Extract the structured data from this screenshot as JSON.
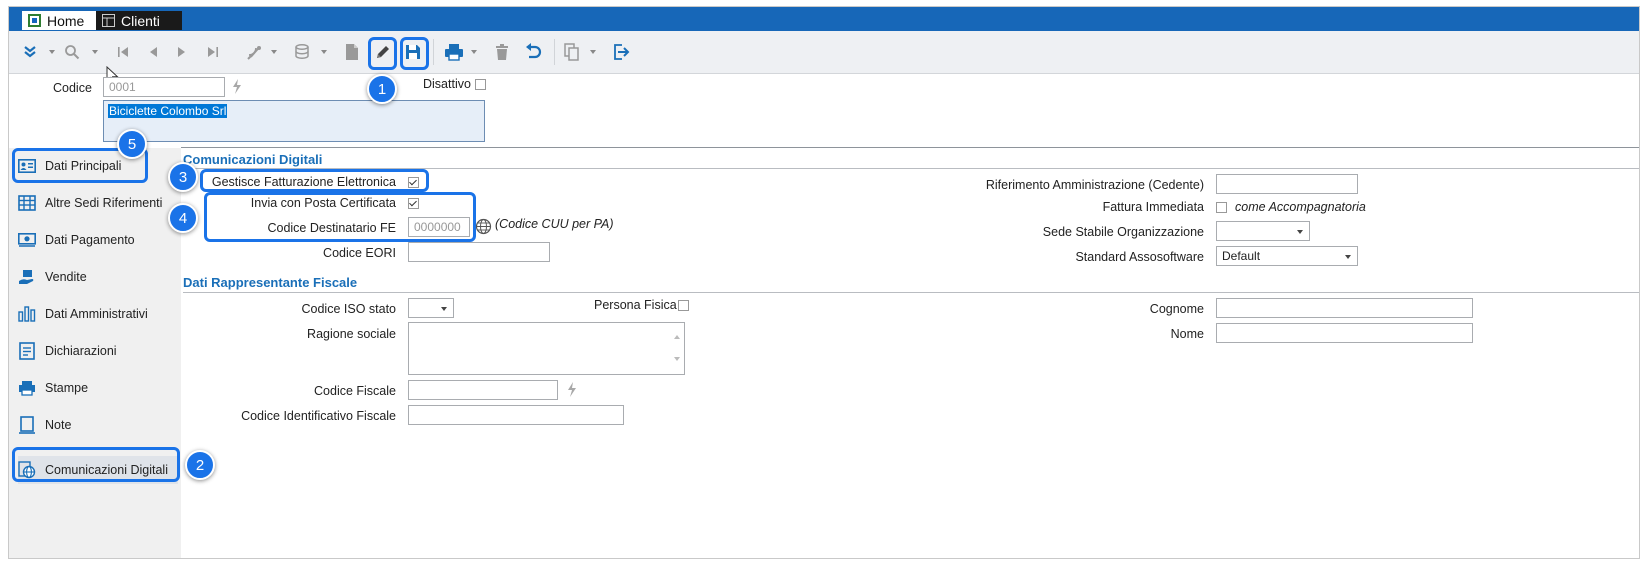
{
  "tabs": [
    {
      "label": "Home"
    },
    {
      "label": "Clienti"
    }
  ],
  "header": {
    "codice_label": "Codice",
    "codice_value": "0001",
    "disattivo_label": "Disattivo",
    "ragione": "Biciclette Colombo Srl"
  },
  "callouts": [
    "1",
    "2",
    "3",
    "4",
    "5"
  ],
  "sidebar": {
    "items": [
      {
        "label": "Dati Principali",
        "icon": "id-card-icon"
      },
      {
        "label": "Altre Sedi Riferimenti",
        "icon": "building-icon"
      },
      {
        "label": "Dati Pagamento",
        "icon": "money-icon"
      },
      {
        "label": "Vendite",
        "icon": "sales-icon"
      },
      {
        "label": "Dati Amministrativi",
        "icon": "chart-icon"
      },
      {
        "label": "Dichiarazioni",
        "icon": "document-icon"
      },
      {
        "label": "Stampe",
        "icon": "printer-icon"
      },
      {
        "label": "Note",
        "icon": "note-icon"
      },
      {
        "label": "Comunicazioni Digitali",
        "icon": "globe-doc-icon"
      }
    ]
  },
  "comunicazioni": {
    "title": "Comunicazioni Digitali",
    "gestisce_label": "Gestisce Fatturazione Elettronica",
    "invia_label": "Invia con Posta Certificata",
    "codice_dest_label": "Codice Destinatario FE",
    "codice_dest_value": "0000000",
    "codice_cuu_note": "(Codice CUU per PA)",
    "eori_label": "Codice EORI",
    "rif_amm_label": "Riferimento Amministrazione (Cedente)",
    "fattura_label": "Fattura Immediata",
    "come_acc": "come Accompagnatoria",
    "sede_label": "Sede Stabile Organizzazione",
    "standard_label": "Standard Assosoftware",
    "standard_value": "Default"
  },
  "rappresentante": {
    "title": "Dati Rappresentante Fiscale",
    "iso_label": "Codice ISO stato",
    "persona_label": "Persona Fisica",
    "ragione_label": "Ragione sociale",
    "cf_label": "Codice Fiscale",
    "cif_label": "Codice Identificativo Fiscale",
    "cognome_label": "Cognome",
    "nome_label": "Nome"
  }
}
